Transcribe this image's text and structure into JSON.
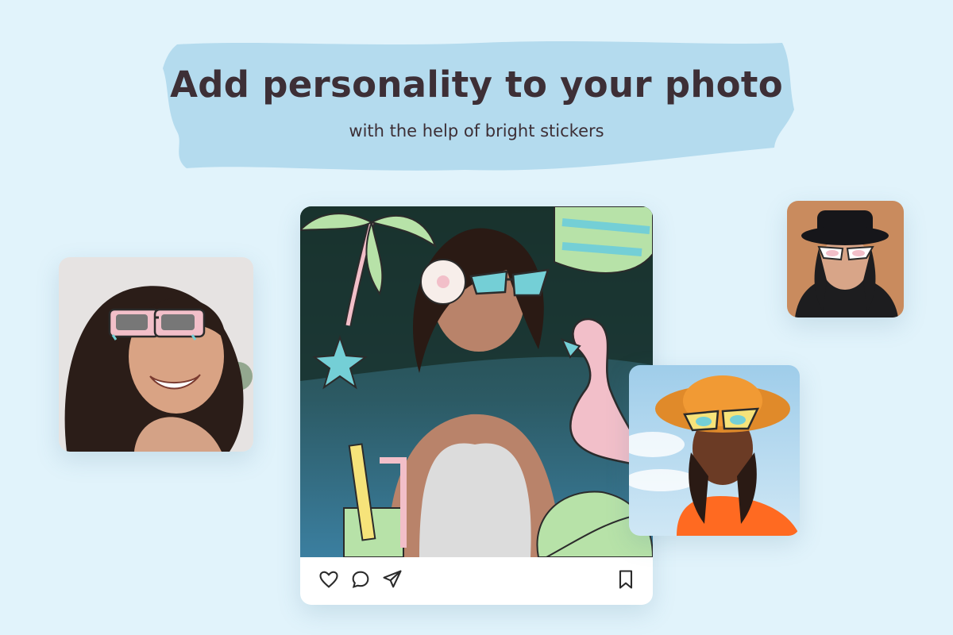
{
  "banner": {
    "headline": "Add personality to your photo",
    "subheadline": "with the help of bright stickers"
  },
  "colors": {
    "background": "#e1f3fb",
    "banner_blob": "#b4dbee",
    "text": "#3d2f36",
    "sticker_pink": "#f2bfc9",
    "sticker_teal": "#74cfd6",
    "sticker_green": "#b7e2a8",
    "sticker_yellow": "#f6e37a"
  },
  "post": {
    "actions": [
      {
        "name": "like",
        "icon": "heart-icon"
      },
      {
        "name": "comment",
        "icon": "comment-icon"
      },
      {
        "name": "share",
        "icon": "send-icon"
      }
    ],
    "save_icon": "bookmark-icon",
    "stickers": [
      "palm-tree-sticker",
      "hibiscus-sticker",
      "cat-eye-glasses-sticker",
      "flamingo-sticker",
      "starfish-sticker",
      "striped-umbrella-sticker",
      "drink-sticker",
      "monstera-leaf-sticker"
    ]
  },
  "photos": [
    {
      "name": "woman-with-pink-sunglasses-photo",
      "sticker": "pink-sunglasses-sticker"
    },
    {
      "name": "woman-with-black-hat-photo",
      "sticker": "white-glasses-sticker"
    },
    {
      "name": "woman-with-orange-hat-photo",
      "sticker": "yellow-glasses-sticker"
    }
  ]
}
